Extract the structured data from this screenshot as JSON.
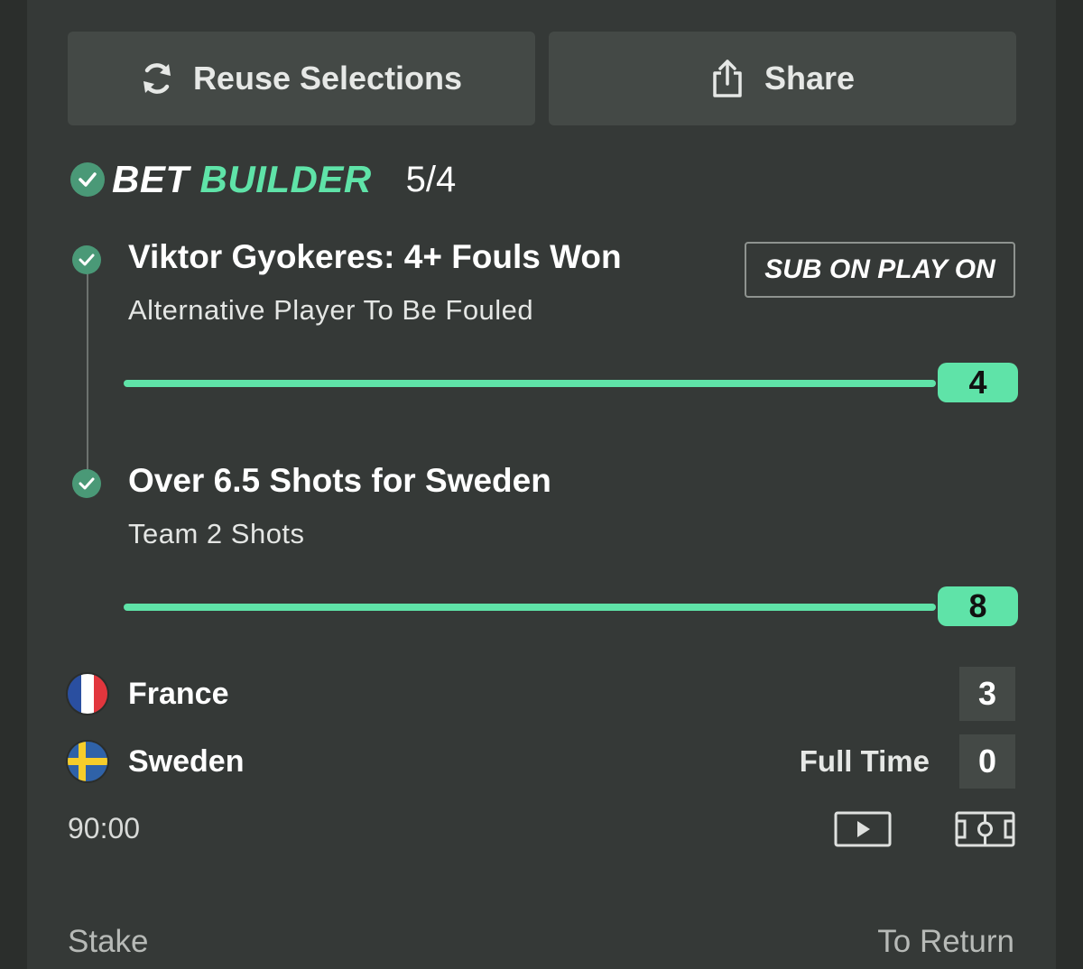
{
  "actions": {
    "reuse_label": "Reuse Selections",
    "share_label": "Share"
  },
  "bet_builder": {
    "word1": "BET",
    "word2": "BUILDER",
    "odds": "5/4"
  },
  "selections": [
    {
      "title": "Viktor Gyokeres: 4+ Fouls Won",
      "market": "Alternative Player To Be Fouled",
      "slider_value": "4",
      "badge": "SUB ON PLAY ON"
    },
    {
      "title": "Over 6.5 Shots for Sweden",
      "market": "Team 2 Shots",
      "slider_value": "8"
    }
  ],
  "match": {
    "home": {
      "name": "France",
      "score": "3",
      "flag_icon": "france-flag-icon"
    },
    "away": {
      "name": "Sweden",
      "score": "0",
      "flag_icon": "sweden-flag-icon"
    },
    "status": "Full Time",
    "clock": "90:00"
  },
  "footer": {
    "stake_label": "Stake",
    "return_label": "To Return"
  },
  "colors": {
    "accent": "#5fe3a8",
    "check": "#4a9977",
    "card": "#353937",
    "button": "#444946"
  }
}
